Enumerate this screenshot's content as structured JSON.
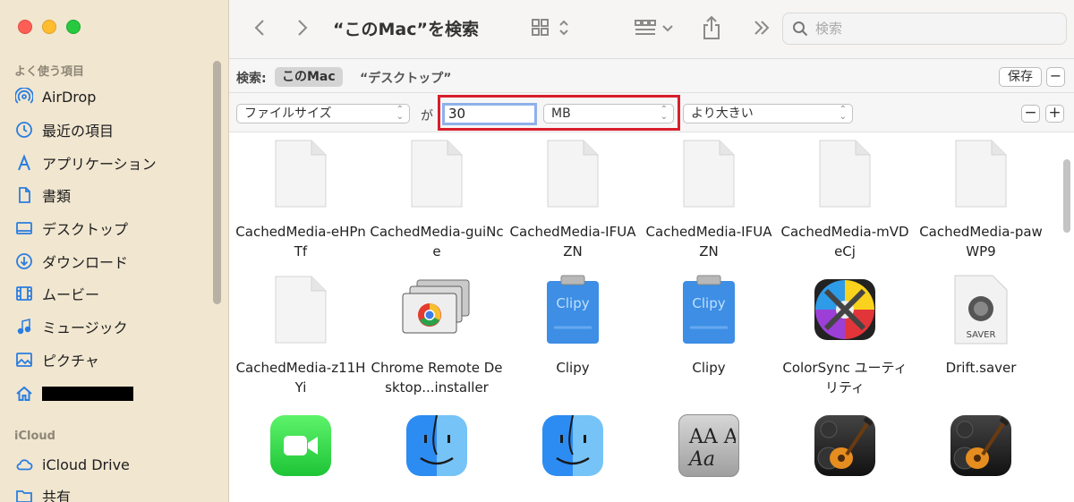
{
  "window": {
    "title": "“このMac”を検索"
  },
  "sidebar": {
    "favorites_heading": "よく使う項目",
    "items": [
      {
        "label": "AirDrop",
        "icon": "airdrop-icon"
      },
      {
        "label": "最近の項目",
        "icon": "clock-icon"
      },
      {
        "label": "アプリケーション",
        "icon": "applications-icon"
      },
      {
        "label": "書類",
        "icon": "document-icon"
      },
      {
        "label": "デスクトップ",
        "icon": "desktop-icon"
      },
      {
        "label": "ダウンロード",
        "icon": "download-icon"
      },
      {
        "label": "ムービー",
        "icon": "movie-icon"
      },
      {
        "label": "ミュージック",
        "icon": "music-icon"
      },
      {
        "label": "ピクチャ",
        "icon": "picture-icon"
      },
      {
        "label": "",
        "icon": "home-icon"
      }
    ],
    "icloud_heading": "iCloud",
    "icloud_items": [
      {
        "label": "iCloud Drive",
        "icon": "cloud-icon"
      },
      {
        "label": "共有",
        "icon": "shared-folder-icon"
      }
    ]
  },
  "toolbar": {
    "search_placeholder": "検索"
  },
  "scope": {
    "label": "検索:",
    "this_mac": "このMac",
    "desktop": "“デスクトップ”",
    "save": "保存",
    "remove": "−"
  },
  "criteria": {
    "attribute": "ファイルサイズ",
    "connector": "が",
    "value": "30",
    "unit": "MB",
    "comparison": "より大きい",
    "remove": "−",
    "add": "+"
  },
  "files": [
    {
      "name": "CachedMedia-eHPnTf",
      "kind": "document"
    },
    {
      "name": "CachedMedia-guiNce",
      "kind": "document"
    },
    {
      "name": "CachedMedia-IFUAZN",
      "kind": "document"
    },
    {
      "name": "CachedMedia-IFUAZN",
      "kind": "document"
    },
    {
      "name": "CachedMedia-mVDeCj",
      "kind": "document"
    },
    {
      "name": "CachedMedia-pawWP9",
      "kind": "document"
    },
    {
      "name": "CachedMedia-z11HYi",
      "kind": "document"
    },
    {
      "name": "Chrome Remote Desktop...installer",
      "kind": "installer"
    },
    {
      "name": "Clipy",
      "kind": "clipy",
      "icon_text": "Clipy"
    },
    {
      "name": "Clipy",
      "kind": "clipy",
      "icon_text": "Clipy"
    },
    {
      "name": "ColorSync ユーティリティ",
      "kind": "colorsync"
    },
    {
      "name": "Drift.saver",
      "kind": "saver",
      "icon_text": "SAVER"
    },
    {
      "name": "",
      "kind": "facetime"
    },
    {
      "name": "",
      "kind": "finder"
    },
    {
      "name": "",
      "kind": "finder"
    },
    {
      "name": "",
      "kind": "fontbook",
      "icon_text": "AA\nAa"
    },
    {
      "name": "",
      "kind": "garageband"
    },
    {
      "name": "",
      "kind": "garageband"
    }
  ]
}
